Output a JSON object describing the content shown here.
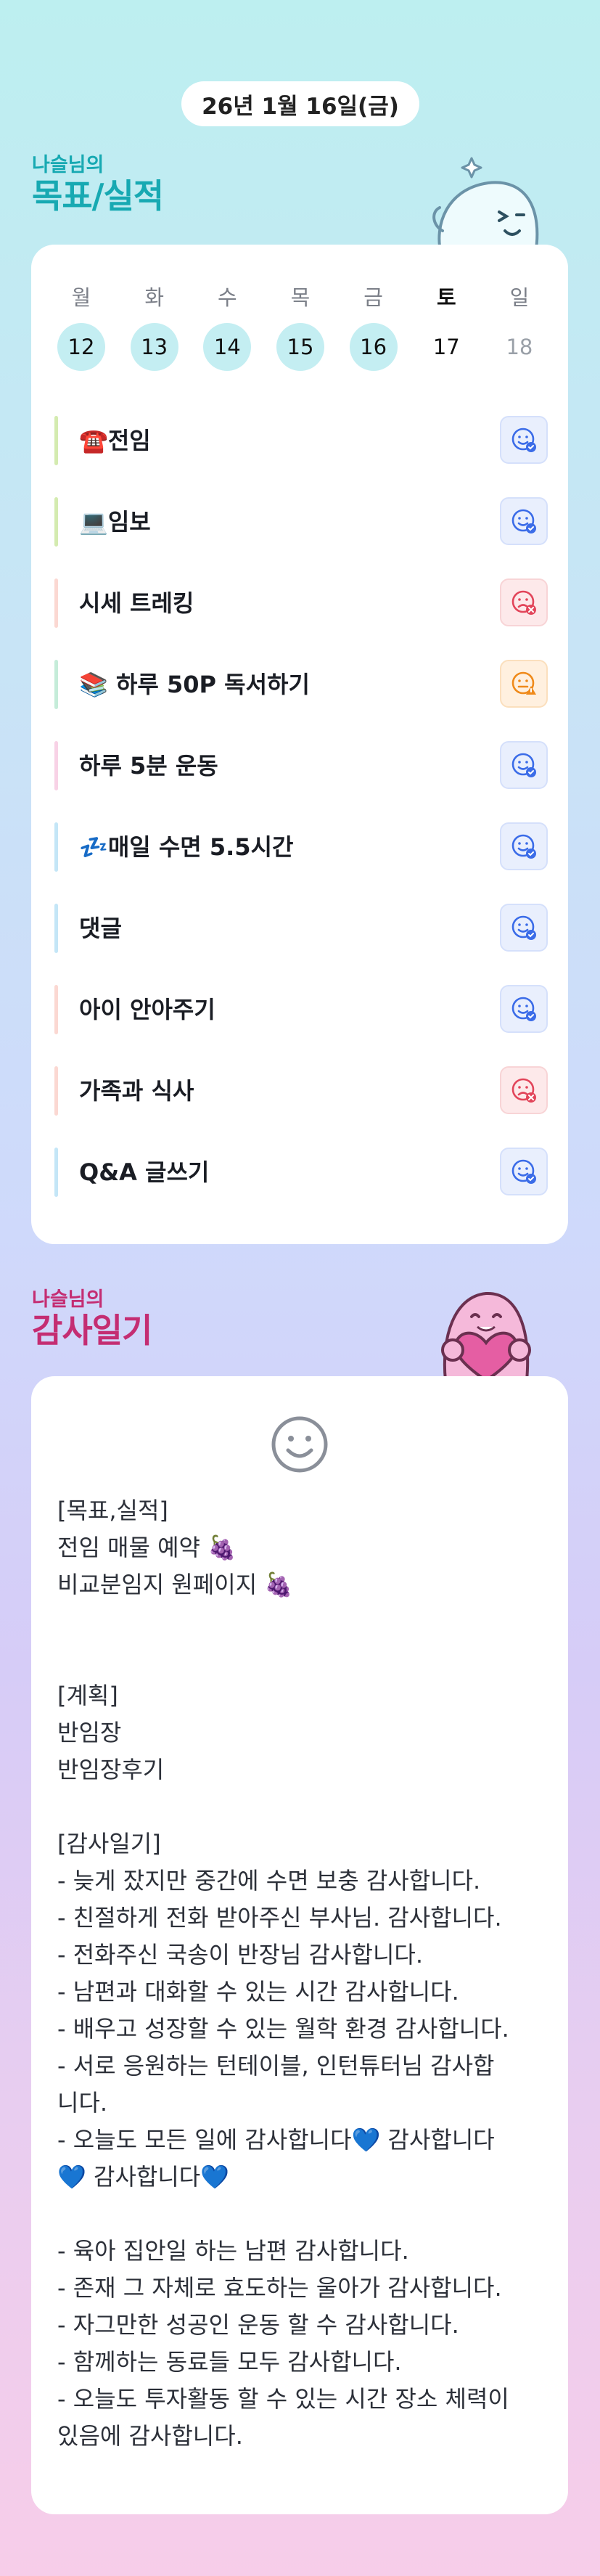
{
  "header": {
    "date": "26년 1월 16일(금)"
  },
  "goals_section": {
    "owner": "나슬님의",
    "title": "목표/실적"
  },
  "week": {
    "days": [
      {
        "name": "월",
        "date": "12"
      },
      {
        "name": "화",
        "date": "13"
      },
      {
        "name": "수",
        "date": "14"
      },
      {
        "name": "목",
        "date": "15"
      },
      {
        "name": "금",
        "date": "16"
      },
      {
        "name": "토",
        "date": "17"
      },
      {
        "name": "일",
        "date": "18"
      }
    ]
  },
  "goals": [
    {
      "label": "☎️전임",
      "bar_color": "#d4ebb0",
      "status": "done",
      "status_color": "#3b6ce8"
    },
    {
      "label": "💻임보",
      "bar_color": "#d4ebb0",
      "status": "done",
      "status_color": "#3b6ce8"
    },
    {
      "label": "시세 트레킹",
      "bar_color": "#fbd8d2",
      "status": "failed",
      "status_color": "#e2455a"
    },
    {
      "label": "📚 하루 50P 독서하기",
      "bar_color": "#c5ecd9",
      "status": "partial",
      "status_color": "#ef8a1a"
    },
    {
      "label": "하루 5분 운동",
      "bar_color": "#f8d2e6",
      "status": "done",
      "status_color": "#3b6ce8"
    },
    {
      "label": "💤매일 수면 5.5시간",
      "bar_color": "#c4e6f7",
      "status": "done",
      "status_color": "#3b6ce8"
    },
    {
      "label": "댓글",
      "bar_color": "#c4e6f7",
      "status": "done",
      "status_color": "#3b6ce8"
    },
    {
      "label": "아이 안아주기",
      "bar_color": "#fbd8d2",
      "status": "done",
      "status_color": "#3b6ce8"
    },
    {
      "label": "가족과 식사",
      "bar_color": "#fbd8d2",
      "status": "failed",
      "status_color": "#e2455a"
    },
    {
      "label": "Q&A 글쓰기",
      "bar_color": "#c4e6f7",
      "status": "done",
      "status_color": "#3b6ce8"
    }
  ],
  "thanks_section": {
    "owner": "나슬님의",
    "title": "감사일기"
  },
  "journal": {
    "lines": [
      "[목표,실적]",
      "전임 매물 예약 🍇",
      "비교분임지 원페이지 🍇",
      "",
      "",
      "[계획]",
      "반임장",
      "반임장후기",
      "",
      "[감사일기]",
      "- 늦게 잤지만 중간에 수면 보충 감사합니다.",
      "- 친절하게 전화 받아주신 부사님. 감사합니다.",
      "- 전화주신 국송이 반장님 감사합니다.",
      "- 남편과 대화할 수 있는 시간 감사합니다.",
      "- 배우고 성장할 수 있는 월학 환경 감사합니다.",
      "- 서로 응원하는 턴테이블, 인턴튜터님 감사합",
      "니다.",
      "- 오늘도 모든 일에 감사합니다💙 감사합니다",
      "💙 감사합니다💙",
      "",
      "- 육아 집안일 하는 남편 감사합니다.",
      "- 존재 그 자체로 효도하는 울아가 감사합니다.",
      "- 자그만한 성공인 운동 할 수 감사합니다.",
      "- 함께하는 동료들 모두 감사합니다.",
      "- 오늘도 투자활동 할 수 있는 시간 장소 체력이",
      "있음에 감사합니다."
    ]
  },
  "colors": {
    "goals_title": "#17a9b2",
    "thanks_title": "#c42d72",
    "highlight_date": "#c4eef2"
  },
  "icons": {
    "goal_mascot": "ghost-mascot-icon",
    "thanks_mascot": "heart-mascot-icon",
    "journal_mood": "smile-icon",
    "status_done": "smile-check-icon",
    "status_failed": "frown-x-icon",
    "status_partial": "neutral-warning-icon"
  }
}
